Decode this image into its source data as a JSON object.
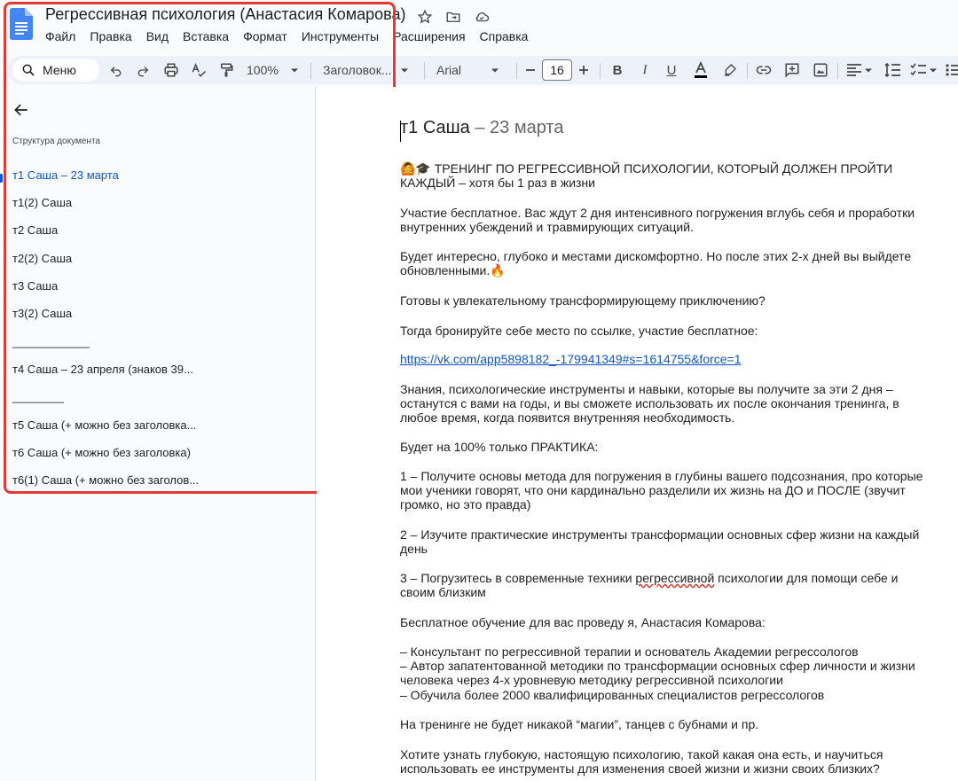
{
  "title": "Регрессивная психология (Анастасия Комарова)",
  "colors": {
    "accent": "#0b57d0",
    "link": "#1155cc",
    "highlight": "#e53935"
  },
  "menu": [
    "Файл",
    "Правка",
    "Вид",
    "Вставка",
    "Формат",
    "Инструменты",
    "Расширения",
    "Справка"
  ],
  "toolbar": {
    "menu_search": "Меню",
    "zoom": "100%",
    "style": "Заголовок...",
    "font": "Arial",
    "font_size": "16"
  },
  "outline": {
    "heading": "Структура документа",
    "items": [
      "т1 Саша – 23 марта",
      "т1(2) Саша",
      "т2 Саша",
      "т2(2) Саша",
      "т3 Саша",
      "т3(2) Саша",
      "____________",
      "т4 Саша – 23 апреля (знаков 39...",
      "________",
      "т5 Саша (+ можно без заголовка...",
      "т6 Саша (+ можно без заголовка)",
      "т6(1) Саша (+ можно без заголов..."
    ]
  },
  "doc": {
    "heading": "т1 Саша",
    "heading_date": "– 23 марта",
    "p1": "🙆🎓 ТРЕНИНГ ПО РЕГРЕССИВНОЙ ПСИХОЛОГИИ, КОТОРЫЙ ДОЛЖЕН ПРОЙТИ КАЖДЫЙ – хотя бы 1 раз в жизни",
    "p2": "Участие бесплатное. Вас ждут 2 дня интенсивного погружения вглубь себя и проработки внутренних убеждений и травмирующих ситуаций.",
    "p3": "Будет интересно, глубоко и местами дискомфортно. Но после этих 2-х дней вы выйдете обновленными.🔥",
    "p4": "Готовы к увлекательному трансформирующему приключению?",
    "p5": "Тогда бронируйте себе место по ссылке, участие бесплатное:",
    "link": "https://vk.com/app5898182_-179941349#s=1614755&force=1",
    "p6": "Знания, психологические инструменты и навыки, которые вы получите за эти 2 дня – останутся с вами на годы, и вы сможете использовать их после окончания тренинга, в любое время, когда появится внутренняя необходимость.",
    "p7": "Будет на 100% только ПРАКТИКА:",
    "p8": "1 – Получите основы метода для погружения в глубины вашего подсознания, про которые мои ученики говорят, что они кардинально разделили их жизнь на ДО и ПОСЛЕ (звучит громко, но это правда)",
    "p9": "2 – Изучите практические инструменты трансформации основных сфер жизни на каждый день",
    "p10_a": "3 – Погрузитесь в современные техники ",
    "p10_b": "регрессивной",
    "p10_c": " психологии для помощи себе и своим близким",
    "p11": "Бесплатное обучение для вас проведу я, Анастасия Комарова:",
    "p12_1": "– Консультант по регрессивной терапии и основатель Академии регрессологов",
    "p12_2": "– Автор запатентованной методики по трансформации основных сфер личности и жизни человека через 4-х уровневую методику регрессивной психологии",
    "p12_3": "– Обучила более 2000 квалифицированных специалистов регрессологов",
    "p13": "На тренинге не будет никакой “магии”, танцев с бубнами и пр.",
    "p14": "Хотите узнать глубокую, настоящую психологию, такой какая она есть, и научиться использовать ее инструменты для изменения своей жизни и жизни своих близких?"
  }
}
